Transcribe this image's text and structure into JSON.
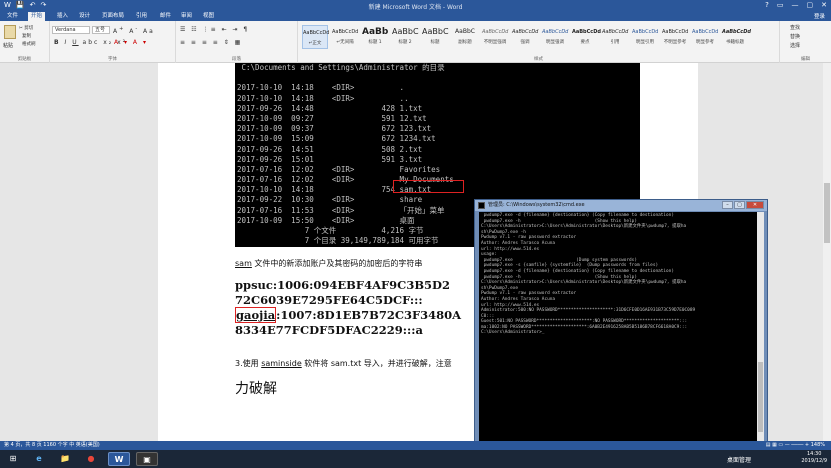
{
  "window": {
    "title": "新建 Microsoft Word 文档 - Word",
    "controls": [
      "?",
      "▭",
      "—",
      "▢",
      "✕"
    ]
  },
  "quick_access": [
    "W",
    "💾",
    "↶",
    "↷"
  ],
  "menu": {
    "tabs": [
      "文件",
      "开始",
      "插入",
      "设计",
      "页面布局",
      "引用",
      "邮件",
      "审阅",
      "视图"
    ],
    "active": "开始",
    "login": "登录"
  },
  "ribbon": {
    "clipboard": {
      "paste": "粘贴",
      "cut": "✂ 剪切",
      "copy": "复制",
      "format_painter": "格式刷",
      "label": "剪贴板"
    },
    "font": {
      "name": "Verdana",
      "size": "五号",
      "label": "字体"
    },
    "paragraph": {
      "label": "段落"
    },
    "styles": {
      "label": "样式",
      "items": [
        {
          "sample": "AaBbCcDd",
          "name": "↵正文"
        },
        {
          "sample": "AaBbCcDd",
          "name": "↵无间隔"
        },
        {
          "sample": "AaBb",
          "name": "标题 1"
        },
        {
          "sample": "AaBbC",
          "name": "标题 2"
        },
        {
          "sample": "AaBbC",
          "name": "标题"
        },
        {
          "sample": "AaBbC",
          "name": "副标题"
        },
        {
          "sample": "AaBbCcDd",
          "name": "不明显强调"
        },
        {
          "sample": "AaBbCcDd",
          "name": "强调"
        },
        {
          "sample": "AaBbCcDd",
          "name": "明显强调"
        },
        {
          "sample": "AaBbCcDd",
          "name": "要点"
        },
        {
          "sample": "AaBbCcDd",
          "name": "引用"
        },
        {
          "sample": "AaBbCcDd",
          "name": "明显引用"
        },
        {
          "sample": "AaBbCcDd",
          "name": "不明显参考"
        },
        {
          "sample": "AaBbCcDd",
          "name": "明显参考"
        },
        {
          "sample": "AaBbCcDd",
          "name": "书籍标题"
        }
      ]
    },
    "editing": {
      "find": "查找",
      "replace": "替换",
      "select": "选择",
      "label": "编辑"
    }
  },
  "doc_cmd": {
    "lines": [
      " C:\\Documents and Settings\\Administrator 的目录",
      "",
      "2017-10-10  14:18    <DIR>          .",
      "2017-10-10  14:18    <DIR>          ..",
      "2017-09-26  14:48               428 1.txt",
      "2017-10-09  09:27               591 12.txt",
      "2017-10-09  09:37               672 123.txt",
      "2017-10-09  15:09               672 1234.txt",
      "2017-09-26  14:51               508 2.txt",
      "2017-09-26  15:01               591 3.txt",
      "2017-07-16  12:02    <DIR>          Favorites",
      "2017-07-16  12:02    <DIR>          My Documents",
      "2017-10-10  14:18               754 sam.txt",
      "2017-09-22  10:30    <DIR>          share",
      "2017-07-16  11:53    <DIR>          「开始」菜单",
      "2017-10-09  15:50    <DIR>          桌面",
      "               7 个文件          4,216 字节",
      "               7 个目录 39,149,789,184 可用字节"
    ]
  },
  "doc_text": {
    "p1_pre": "sam",
    "p1_post": " 文件中的新添加账户及其密码的加密后的字符串",
    "hash_lines": [
      "ppsuc:1006:094EBF4AF9C3B5D2",
      "72C6039E7295FE64C5DCF:::",
      "gaojia:1007:8D1EB7B72C3F3480A",
      "8334E77FCDF5DFAC2229:::a"
    ],
    "gaojia": "gaojia",
    "p3_pre": "3.使用 ",
    "p3_tool": "saminside",
    "p3_post": " 软件将 sam.txt 导入，并进行破解，注意",
    "h2": "力破解"
  },
  "cmd_window": {
    "title": "管理员: C:\\Windows\\system32\\cmd.exe",
    "lines": [
      " pwdump7.exe -d {filename} {destionation} (Copy filename to destionation)",
      " pwdump7.exe -h                            (Show this help)",
      "",
      "C:\\Users\\Administrator>C:\\Users\\Administrator\\Desktop\\新建文件夹\\pwdump7, 提取ha",
      "sh\\PwDump7.exe -h",
      "Pwdump v7.1 - raw password extractor",
      "Author: Andres Tarasco Acuna",
      "url: http://www.514.es",
      "",
      "usage:",
      " pwdump7.exe                        (Dump system passwords)",
      " pwdump7.exe -s {samfile} {systemfile}  (Dump passwords from files)",
      " pwdump7.exe -d {filename} {destionation} (Copy filename to destionation)",
      " pwdump7.exe -h                            (Show this help)",
      "",
      "C:\\Users\\Administrator>C:\\Users\\Administrator\\Desktop\\新建文件夹\\pwdump7, 提取ha",
      "sh\\PwDump7.exe",
      "Pwdump v7.1 - raw password extractor",
      "Author: Andres Tarasco Acuna",
      "url: http://www.514.es",
      "",
      "Administrator:500:NO PASSWORD*********************:31D6CFE0D16AE931B73C59D7E0C089",
      "C0:::",
      "Guest:501:NO PASSWORD*********************:NO PASSWORD*********************:::",
      "ma:1002:NO PASSWORD*********************:6A0B2E4916258AB5B5186B78CF6618A0C9:::",
      "",
      "C:\\Users\\Administrator>_"
    ]
  },
  "status": {
    "left": "第 4 页，共 8 页    1160 个字    中    英语(美国)",
    "right": "▤  ▦  ▭   —  ────  +   148%"
  },
  "taskbar": {
    "items": [
      "⊞",
      "e",
      "📁",
      "●",
      "W",
      "▣"
    ],
    "label": "桌面管理",
    "time": "14:30",
    "date": "2019/12/9"
  },
  "colors": {
    "accent": "#2b579a",
    "red_box": "#dd2222"
  }
}
